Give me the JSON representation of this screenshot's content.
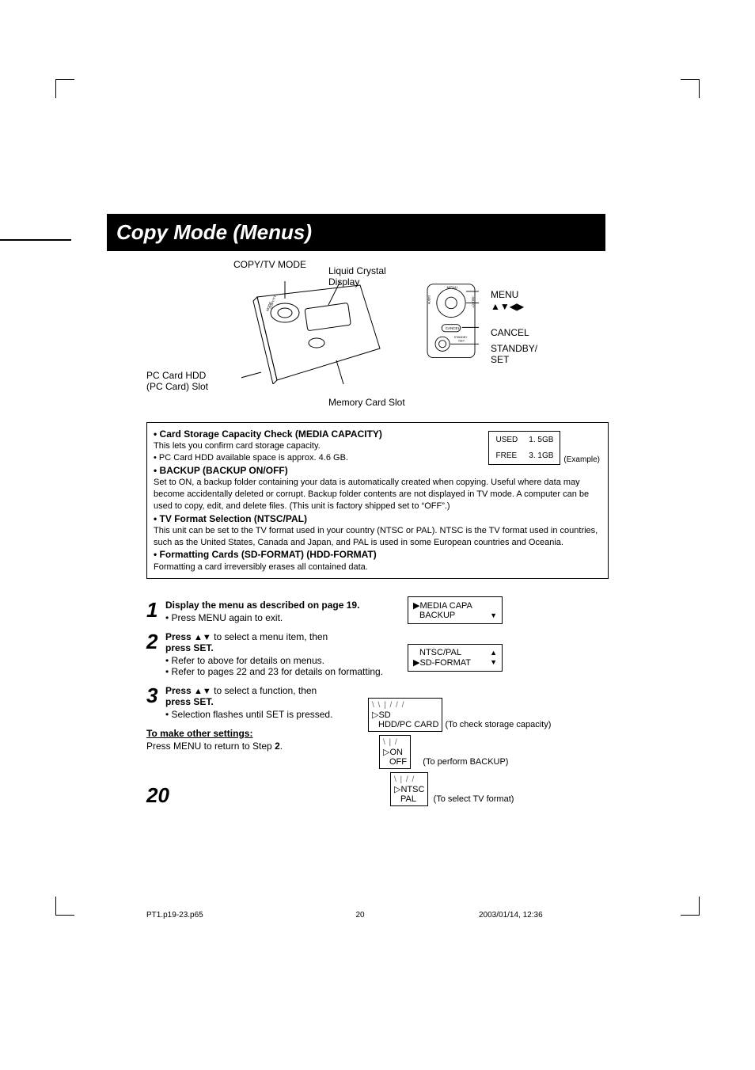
{
  "title": "Copy Mode (Menus)",
  "diagram": {
    "copy_tv_mode": "COPY/TV MODE",
    "lcd": "Liquid Crystal\nDisplay",
    "pc_card": "PC Card HDD\n(PC Card) Slot",
    "memory_card": "Memory Card Slot",
    "mode_text": "COPY/TV\nMODE",
    "remote_menu_t": "MENU",
    "remote": {
      "menu": "MENU",
      "cancel": "CANCEL",
      "standby": "STANDBY/\nSET",
      "select_t": "-SELECT",
      "audio_t": "AUDIO",
      "arrows": "▲▼◀▶"
    }
  },
  "box": {
    "h1_bullet": "• Card Storage Capacity Check (MEDIA CAPACITY)",
    "h1_l1": "This lets you confirm card storage capacity.",
    "h1_l2": "•  PC Card HDD available space is approx. 4.6 GB.",
    "lcd_used_l": "USED",
    "lcd_used_v": "1. 5GB",
    "lcd_free_l": "FREE",
    "lcd_free_v": "3. 1GB",
    "lcd_example": "(Example)",
    "h2_bullet": "• BACKUP (BACKUP ON/OFF)",
    "h2_p": "Set to ON, a backup folder containing your data is automatically created when copying. Useful where data may become accidentally deleted or corrupt. Backup folder contents are not displayed in TV mode. A computer can be used to copy, edit, and delete files. (This unit is factory shipped set to “OFF”.)",
    "h3_bullet": "• TV Format Selection (NTSC/PAL)",
    "h3_p": "This unit can be set to the TV format used in your country (NTSC or PAL). NTSC is the TV format used in countries, such as the United States, Canada and Japan, and PAL is used in some European countries and Oceania.",
    "h4_bullet": "• Formatting Cards (SD-FORMAT) (HDD-FORMAT)",
    "h4_p": "Formatting a card irreversibly erases all contained data."
  },
  "steps": {
    "s1_lead": "Display the menu as described on page 19.",
    "s1_b1": "Press MENU again to exit.",
    "s2_lead_a": "Press ",
    "s2_lead_b": " to select a menu item, then ",
    "s2_lead_c": "press SET",
    "s2_b1": "Refer to above for details on menus.",
    "s2_b2": "Refer to pages 22 and 23 for details on formatting.",
    "s3_lead_a": "Press ",
    "s3_lead_b": " to select a function, then ",
    "s3_lead_c": "press SET",
    "s3_b1": "Selection flashes until SET is pressed.",
    "other_h": "To make other settings:",
    "other_p_a": "Press MENU to return to Step ",
    "other_p_b": "2",
    "other_p_c": "."
  },
  "mini_lcd1": {
    "r1a": "▶MEDIA CAPA",
    "r2a": "BACKUP",
    "r2t": "▼"
  },
  "mini_lcd2": {
    "r1a": "NTSC/PAL",
    "r1t": "▲",
    "r2a": "▶SD-FORMAT",
    "r2t": "▼"
  },
  "func": {
    "c1a": "▷SD",
    "c1b": "HDD/PC CARD",
    "c1cap": "(To check storage capacity)",
    "c2a": "▷ON",
    "c2b": "OFF",
    "c2cap": "(To perform BACKUP)",
    "c3a": "▷NTSC",
    "c3b": "PAL",
    "c3cap": "(To select TV format)"
  },
  "page_number": "20",
  "footer": {
    "file": "PT1.p19-23.p65",
    "page": "20",
    "date": "2003/01/14, 12:36"
  }
}
